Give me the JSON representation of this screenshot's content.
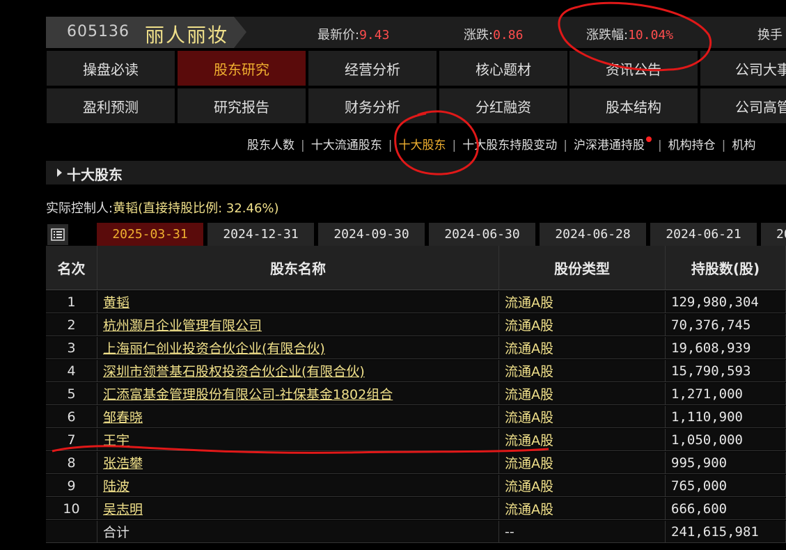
{
  "stock": {
    "code": "605136",
    "name": "丽人丽妆",
    "metrics": [
      {
        "label": "最新价:",
        "value": "9.43"
      },
      {
        "label": "涨跌:",
        "value": "0.86"
      },
      {
        "label": "涨跌幅:",
        "value": "10.04%"
      },
      {
        "label": "换手",
        "value": ""
      }
    ]
  },
  "nav": {
    "row1": [
      "操盘必读",
      "股东研究",
      "经营分析",
      "核心题材",
      "资讯公告",
      "公司大事"
    ],
    "row2": [
      "盈利预测",
      "研究报告",
      "财务分析",
      "分红融资",
      "股本结构",
      "公司高管"
    ],
    "active": "股东研究"
  },
  "subtabs": {
    "items": [
      "股东人数",
      "十大流通股东",
      "十大股东",
      "十大股东持股变动",
      "沪深港通持股",
      "机构持仓",
      "机构"
    ],
    "active": "十大股东"
  },
  "section": {
    "title": "十大股东"
  },
  "controller": {
    "label": "实际控制人:",
    "name": "黄韬",
    "detail": "(直接持股比例: 32.46%)"
  },
  "dates": {
    "items": [
      "2025-03-31",
      "2024-12-31",
      "2024-09-30",
      "2024-06-30",
      "2024-06-28",
      "2024-06-21",
      "20"
    ],
    "active": "2025-03-31"
  },
  "table": {
    "headers": [
      "名次",
      "股东名称",
      "股份类型",
      "持股数(股)"
    ],
    "rows": [
      {
        "rank": "1",
        "name": "黄韬",
        "type": "流通A股",
        "shares": "129,980,304"
      },
      {
        "rank": "2",
        "name": "杭州灏月企业管理有限公司",
        "type": "流通A股",
        "shares": "70,376,745"
      },
      {
        "rank": "3",
        "name": "上海丽仁创业投资合伙企业(有限合伙)",
        "type": "流通A股",
        "shares": "19,608,939"
      },
      {
        "rank": "4",
        "name": "深圳市领誉基石股权投资合伙企业(有限合伙)",
        "type": "流通A股",
        "shares": "15,790,593"
      },
      {
        "rank": "5",
        "name": "汇添富基金管理股份有限公司-社保基金1802组合",
        "type": "流通A股",
        "shares": "1,271,000"
      },
      {
        "rank": "6",
        "name": "邹春晓",
        "type": "流通A股",
        "shares": "1,110,900"
      },
      {
        "rank": "7",
        "name": "王宇",
        "type": "流通A股",
        "shares": "1,050,000"
      },
      {
        "rank": "8",
        "name": "张浩攀",
        "type": "流通A股",
        "shares": "995,900"
      },
      {
        "rank": "9",
        "name": "陆波",
        "type": "流通A股",
        "shares": "765,000"
      },
      {
        "rank": "10",
        "name": "吴志明",
        "type": "流通A股",
        "shares": "666,600"
      }
    ],
    "total": {
      "label": "合计",
      "type": "--",
      "shares": "241,615,981"
    }
  },
  "colors": {
    "accent": "#f0b030",
    "active_bg": "#5a0b0b",
    "link": "#f0e08a",
    "up": "#ff4d4d",
    "annotation": "#e01818"
  }
}
